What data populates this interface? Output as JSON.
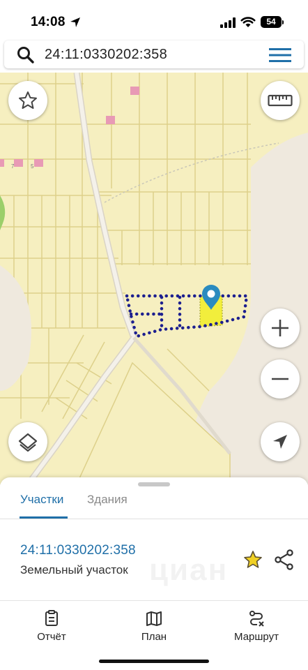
{
  "status_bar": {
    "time": "14:08",
    "battery": "54"
  },
  "search": {
    "query": "24:11:0330202:358"
  },
  "map": {
    "plot_labels": [
      "7",
      "5"
    ],
    "colors": {
      "land": "#f6efc0",
      "parcel_line": "#ddd08a",
      "selected_fill": "#f2ee3c",
      "boundary_dots": "#1c1f8f",
      "marker": "#2a8bbf",
      "building": "#e89ab5"
    }
  },
  "sheet": {
    "tabs": [
      {
        "label": "Участки",
        "active": true
      },
      {
        "label": "Здания",
        "active": false
      }
    ],
    "result": {
      "number": "24:11:0330202:358",
      "type": "Земельный участок"
    },
    "watermark": "циан"
  },
  "nav": [
    {
      "label": "Отчёт",
      "icon": "report-icon"
    },
    {
      "label": "План",
      "icon": "map-plan-icon"
    },
    {
      "label": "Маршрут",
      "icon": "route-icon"
    }
  ],
  "icons": [
    "location-arrow-icon",
    "signal-icon",
    "wifi-icon",
    "battery-icon",
    "search-icon",
    "menu-icon",
    "star-icon",
    "ruler-icon",
    "plus-icon",
    "minus-icon",
    "layers-icon",
    "navigation-arrow-icon",
    "share-icon"
  ]
}
